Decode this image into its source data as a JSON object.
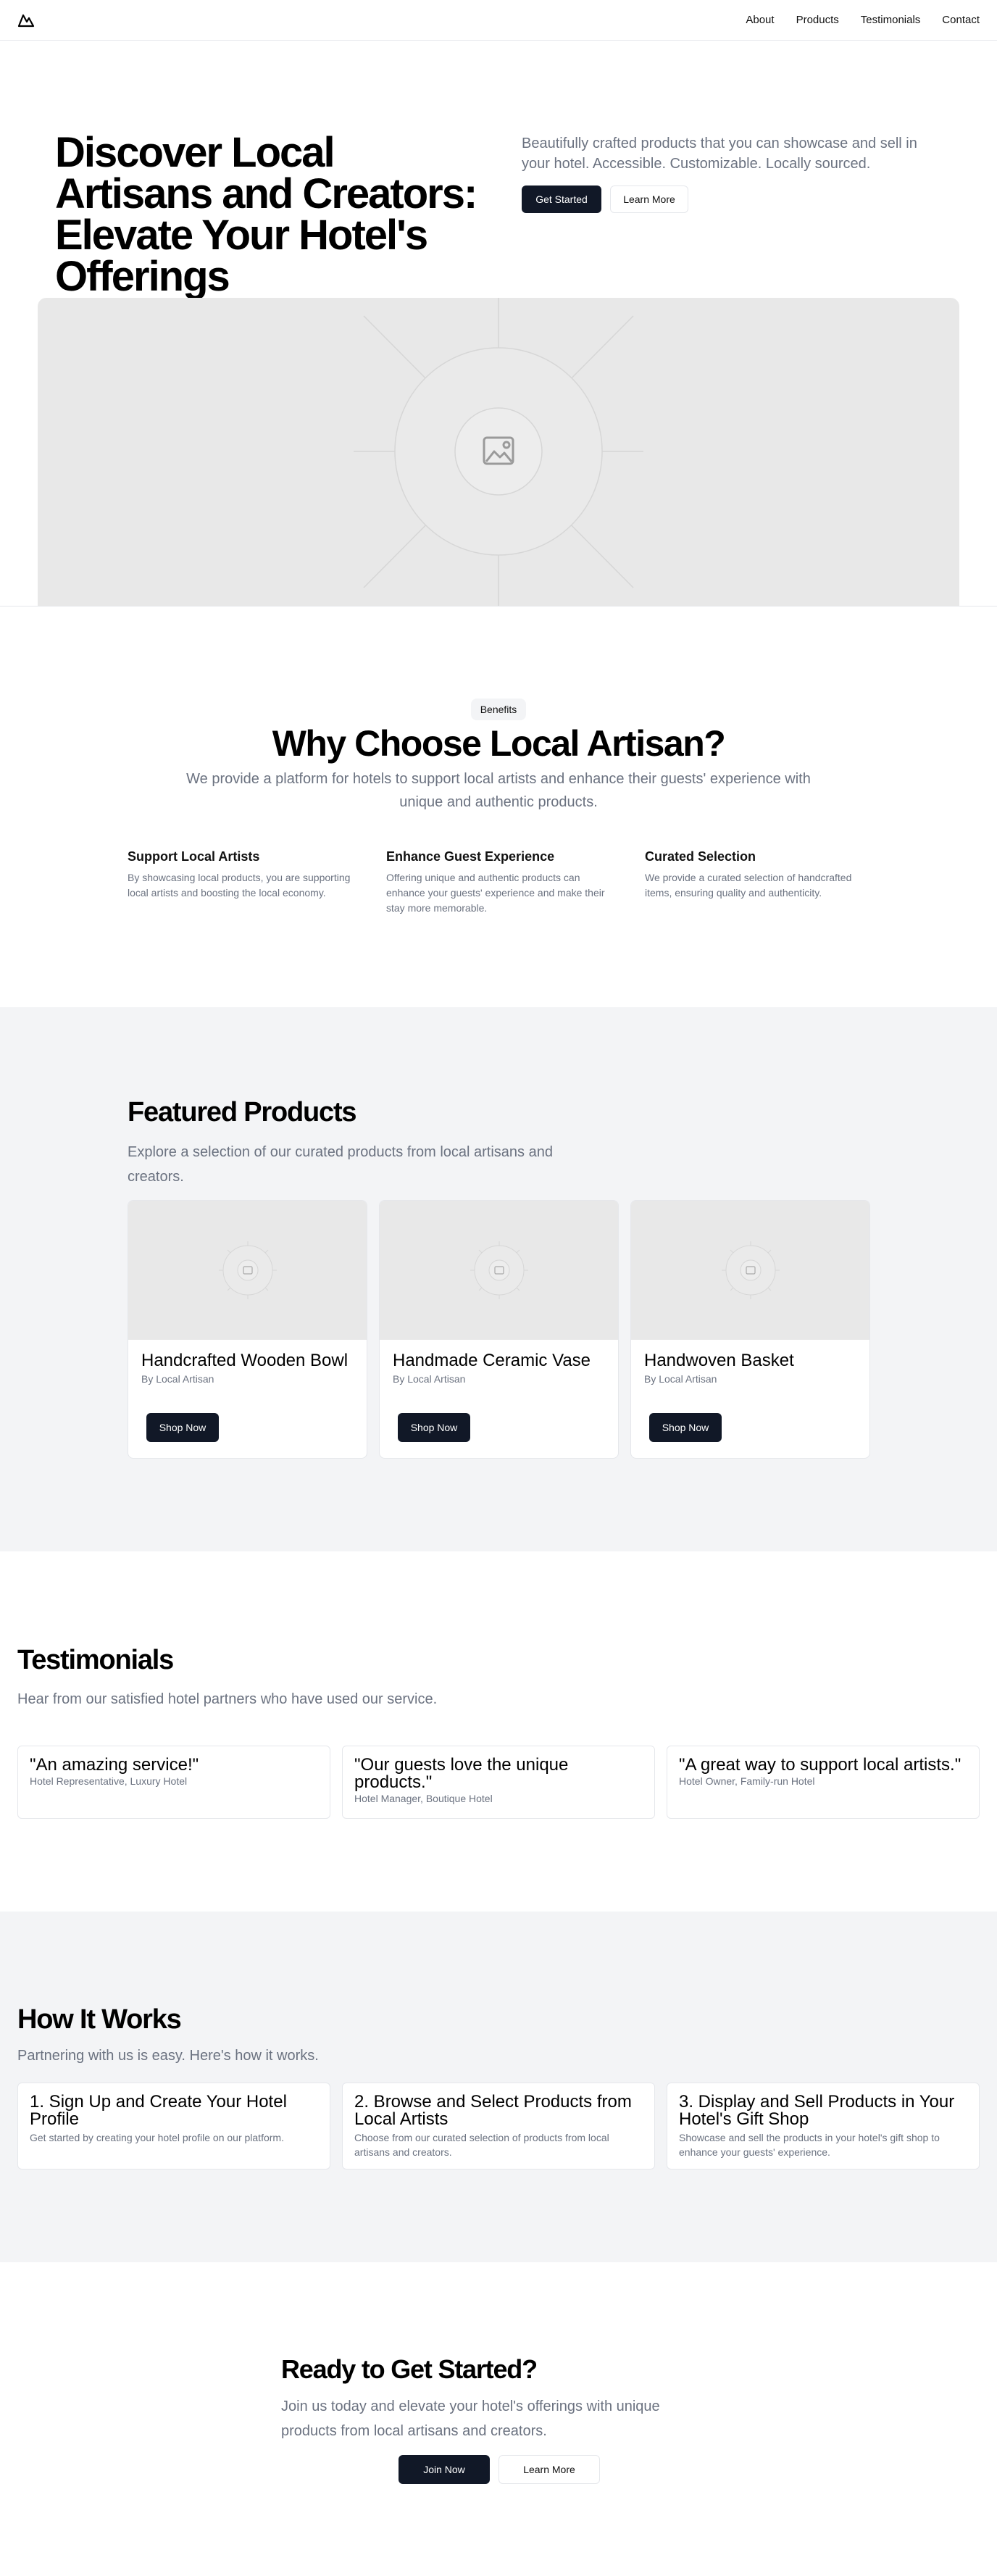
{
  "nav": {
    "logo_icon": "mountain-logo-icon",
    "links": [
      "About",
      "Products",
      "Testimonials",
      "Contact"
    ]
  },
  "hero": {
    "title": "Discover Local Artisans and Creators: Elevate Your Hotel's Offerings",
    "subtitle": "Beautifully crafted products that you can showcase and sell in your hotel. Accessible. Customizable. Locally sourced.",
    "primary_button": "Get Started",
    "secondary_button": "Learn More",
    "image_icon": "image-placeholder-icon"
  },
  "benefits": {
    "badge": "Benefits",
    "title": "Why Choose Local Artisan?",
    "subtitle": "We provide a platform for hotels to support local artists and enhance their guests' experience with unique and authentic products.",
    "items": [
      {
        "title": "Support Local Artists",
        "text": "By showcasing local products, you are supporting local artists and boosting the local economy."
      },
      {
        "title": "Enhance Guest Experience",
        "text": "Offering unique and authentic products can enhance your guests' experience and make their stay more memorable."
      },
      {
        "title": "Curated Selection",
        "text": "We provide a curated selection of handcrafted items, ensuring quality and authenticity."
      }
    ]
  },
  "featured": {
    "title": "Featured Products",
    "subtitle": "Explore a selection of our curated products from local artisans and creators.",
    "products": [
      {
        "name": "Handcrafted Wooden Bowl",
        "by": "By Local Artisan",
        "button": "Shop Now"
      },
      {
        "name": "Handmade Ceramic Vase",
        "by": "By Local Artisan",
        "button": "Shop Now"
      },
      {
        "name": "Handwoven Basket",
        "by": "By Local Artisan",
        "button": "Shop Now"
      }
    ]
  },
  "testimonials": {
    "title": "Testimonials",
    "subtitle": "Hear from our satisfied hotel partners who have used our service.",
    "items": [
      {
        "quote": "\"An amazing service!\"",
        "author": "Hotel Representative, Luxury Hotel"
      },
      {
        "quote": "\"Our guests love the unique products.\"",
        "author": "Hotel Manager, Boutique Hotel"
      },
      {
        "quote": "\"A great way to support local artists.\"",
        "author": "Hotel Owner, Family-run Hotel"
      }
    ]
  },
  "how": {
    "title": "How It Works",
    "subtitle": "Partnering with us is easy. Here's how it works.",
    "steps": [
      {
        "title": "1. Sign Up and Create Your Hotel Profile",
        "text": "Get started by creating your hotel profile on our platform."
      },
      {
        "title": "2. Browse and Select Products from Local Artists",
        "text": "Choose from our curated selection of products from local artisans and creators."
      },
      {
        "title": "3. Display and Sell Products in Your Hotel's Gift Shop",
        "text": "Showcase and sell the products in your hotel's gift shop to enhance your guests' experience."
      }
    ]
  },
  "cta": {
    "title": "Ready to Get Started?",
    "subtitle": "Join us today and elevate your hotel's offerings with unique products from local artisans and creators.",
    "primary_button": "Join Now",
    "secondary_button": "Learn More"
  }
}
